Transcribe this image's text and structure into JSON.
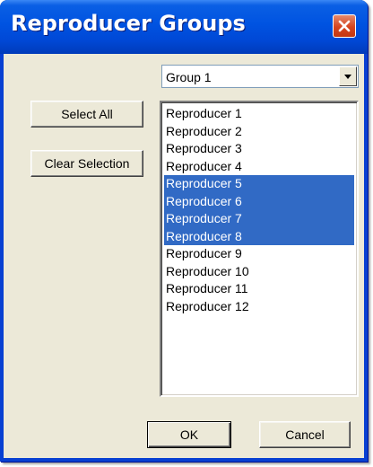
{
  "window": {
    "title": "Reproducer Groups"
  },
  "group_select": {
    "value": "Group 1"
  },
  "buttons": {
    "select_all": "Select All",
    "clear_selection": "Clear Selection",
    "ok": "OK",
    "cancel": "Cancel"
  },
  "reproducers": {
    "items": [
      {
        "label": "Reproducer 1",
        "selected": false
      },
      {
        "label": "Reproducer 2",
        "selected": false
      },
      {
        "label": "Reproducer 3",
        "selected": false
      },
      {
        "label": "Reproducer 4",
        "selected": false
      },
      {
        "label": "Reproducer 5",
        "selected": true
      },
      {
        "label": "Reproducer 6",
        "selected": true
      },
      {
        "label": "Reproducer 7",
        "selected": true
      },
      {
        "label": "Reproducer 8",
        "selected": true
      },
      {
        "label": "Reproducer 9",
        "selected": false
      },
      {
        "label": "Reproducer 10",
        "selected": false
      },
      {
        "label": "Reproducer 11",
        "selected": false
      },
      {
        "label": "Reproducer 12",
        "selected": false
      }
    ]
  },
  "colors": {
    "selection": "#316ac5",
    "dialog_face": "#ece9d8",
    "title_bar": "#0053e1",
    "close_button": "#d6441f"
  },
  "icons": {
    "close": "close-icon",
    "dropdown": "chevron-down-icon"
  }
}
